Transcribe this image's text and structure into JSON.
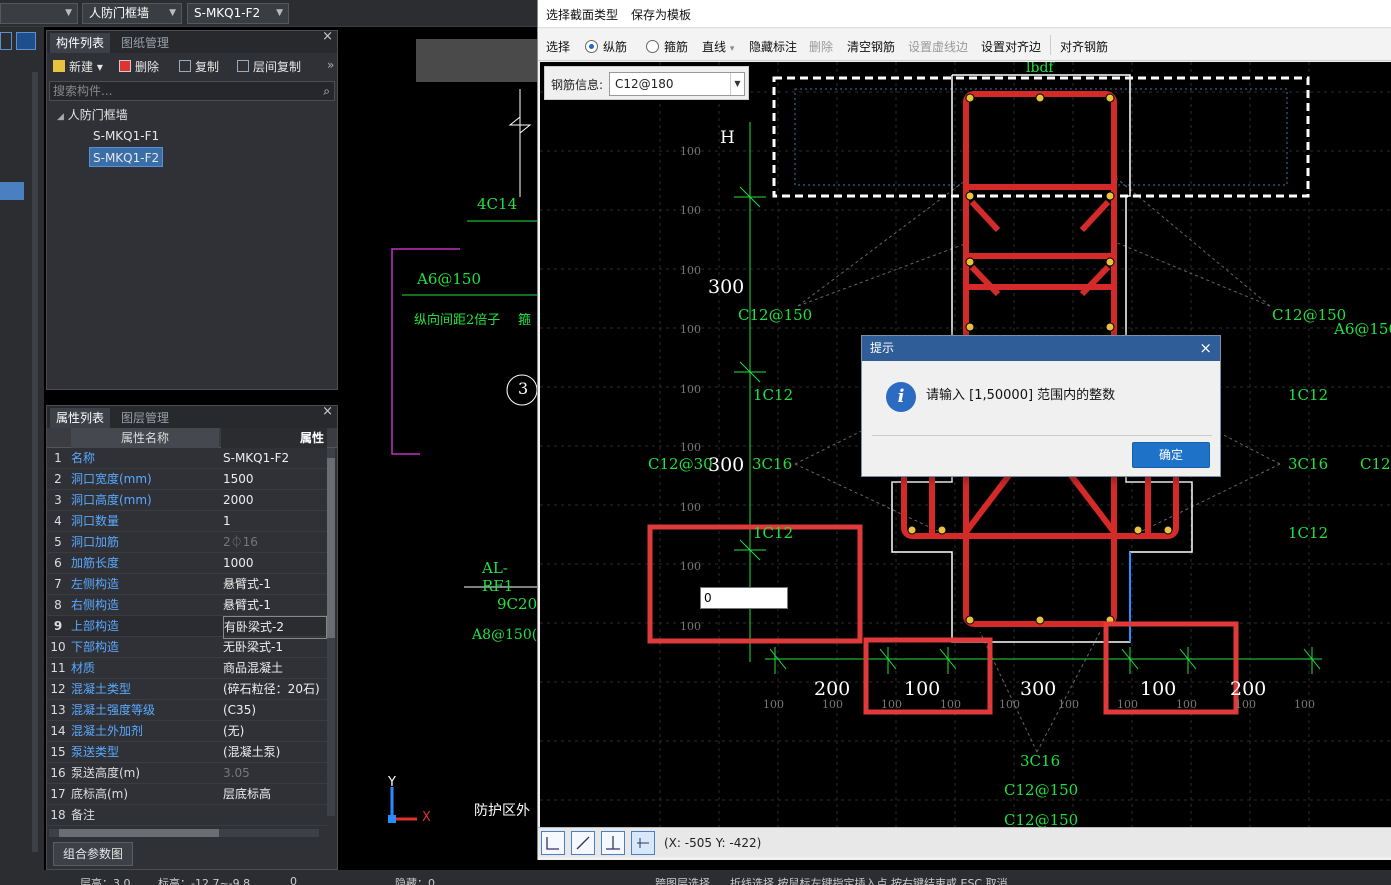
{
  "topbar": {
    "dropdown_left": "",
    "dropdown_type": "人防门框墙",
    "dropdown_component": "S-MKQ1-F2"
  },
  "component_panel": {
    "tabs": [
      "构件列表",
      "图纸管理"
    ],
    "toolbar": {
      "new": "新建",
      "delete": "删除",
      "copy": "复制",
      "floor_copy": "层间复制"
    },
    "search_placeholder": "搜索构件...",
    "tree": {
      "root": "人防门框墙",
      "items": [
        "S-MKQ1-F1",
        "S-MKQ1-F2"
      ]
    }
  },
  "property_panel": {
    "tabs": [
      "属性列表",
      "图层管理"
    ],
    "headers": {
      "name": "属性名称",
      "value": "属性"
    },
    "rows": [
      {
        "n": "1",
        "k": "名称",
        "v": "S-MKQ1-F2"
      },
      {
        "n": "2",
        "k": "洞口宽度(mm)",
        "v": "1500"
      },
      {
        "n": "3",
        "k": "洞口高度(mm)",
        "v": "2000"
      },
      {
        "n": "4",
        "k": "洞口数量",
        "v": "1"
      },
      {
        "n": "5",
        "k": "洞口加筋",
        "v": "2⏀16"
      },
      {
        "n": "6",
        "k": "加筋长度",
        "v": "1000"
      },
      {
        "n": "7",
        "k": "左侧构造",
        "v": "悬臂式-1"
      },
      {
        "n": "8",
        "k": "右侧构造",
        "v": "悬臂式-1"
      },
      {
        "n": "9",
        "k": "上部构造",
        "v": "有卧梁式-2"
      },
      {
        "n": "10",
        "k": "下部构造",
        "v": "无卧梁式-1"
      },
      {
        "n": "11",
        "k": "材质",
        "v": "商品混凝土"
      },
      {
        "n": "12",
        "k": "混凝土类型",
        "v": "(碎石粒径：20石)"
      },
      {
        "n": "13",
        "k": "混凝土强度等级",
        "v": "(C35)"
      },
      {
        "n": "14",
        "k": "混凝土外加剂",
        "v": "(无)"
      },
      {
        "n": "15",
        "k": "泵送类型",
        "v": "(混凝土泵)"
      },
      {
        "n": "16",
        "k": "泵送高度(m)",
        "v": "3.05"
      },
      {
        "n": "17",
        "k": "底标高(m)",
        "v": "层底标高"
      },
      {
        "n": "18",
        "k": "备注",
        "v": ""
      }
    ],
    "footer_button": "组合参数图"
  },
  "canvas_labels": {
    "l1": "4C14",
    "l2": "A6@150",
    "l3": "纵向间距2倍子",
    "l4": "箍",
    "l5": "3",
    "l6": "AL-RF1",
    "l7": "9C20",
    "l8": "A8@150(箍",
    "l9": "防护区外",
    "axis_y": "Y",
    "axis_x": "X"
  },
  "dialog": {
    "menu": [
      "选择截面类型",
      "保存为模板"
    ],
    "toolbar": {
      "select": "选择",
      "longitudinal": "纵筋",
      "stirrup": "箍筋",
      "line": "直线",
      "hide_mark": "隐藏标注",
      "delete": "删除",
      "clear": "清空钢筋",
      "set_dashed": "设置虚线边",
      "align_edge": "设置对齐边",
      "align_rebar": "对齐钢筋"
    },
    "rebar_info_label": "钢筋信息:",
    "rebar_info_value": "C12@180",
    "coords": "(X: -505 Y: -422)",
    "input_value": "0",
    "drawing_labels": {
      "H": "H",
      "lbdf": "lbdf",
      "d300a": "300",
      "d300b": "300",
      "c12_150_l": "C12@150",
      "c12_150_r": "C12@150",
      "a6_150": "A6@150",
      "1c12_a": "1C12",
      "1c12_b": "1C12",
      "1c12_c": "1C12",
      "1c12_d": "1C12",
      "c12_30": "C12@30",
      "3c16_l": "3C16",
      "3c16_r": "3C16",
      "c12_r": "C12",
      "dim200a": "200",
      "dim100a": "100",
      "dim300": "300",
      "dim100b": "100",
      "dim200b": "200",
      "b3c16": "3C16",
      "bc12_1": "C12@150",
      "bc12_2": "C12@150",
      "grid100": "100"
    }
  },
  "modal": {
    "title": "提示",
    "message": "请输入 [1,50000] 范围内的整数",
    "ok": "确定"
  },
  "bottom": {
    "text1": "层高：3.0",
    "text2": "标高：-12.7~-9.8",
    "text3": "0",
    "text4": "隐藏：0",
    "text5": "跨图层选择",
    "text6": "折线选择 按鼠标左键指定插入点,按右键结束或 ESC 取消"
  }
}
